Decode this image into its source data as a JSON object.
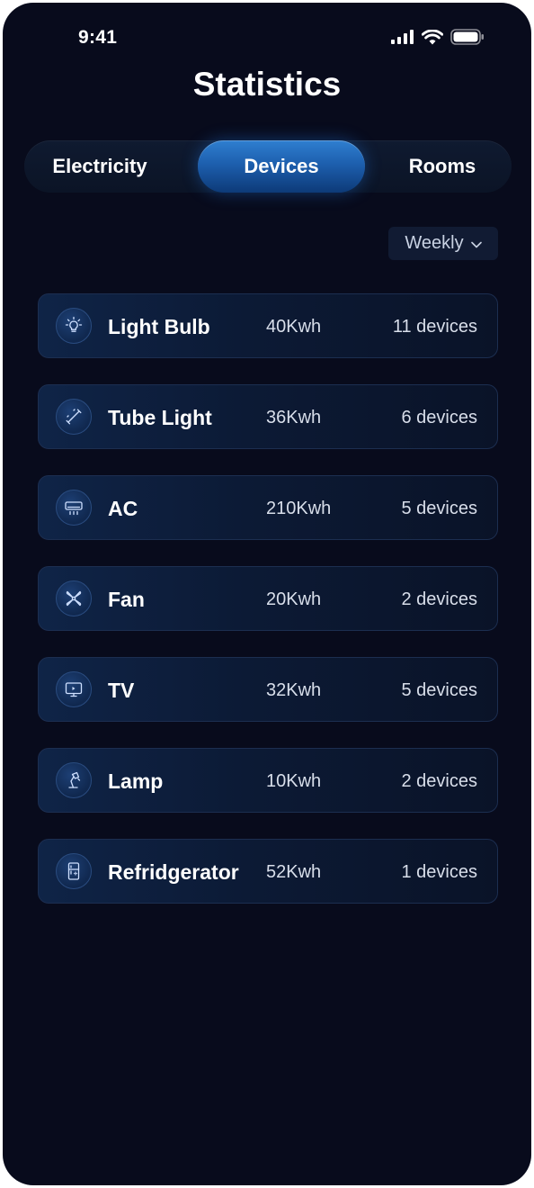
{
  "status_bar": {
    "time": "9:41",
    "icons": [
      "signal-icon",
      "wifi-icon",
      "battery-icon"
    ]
  },
  "header": {
    "title": "Statistics"
  },
  "tabs": [
    {
      "label": "Electricity",
      "active": false
    },
    {
      "label": "Devices",
      "active": true
    },
    {
      "label": "Rooms",
      "active": false
    }
  ],
  "period_filter": {
    "selected": "Weekly",
    "icon": "chevron-down-icon"
  },
  "devices": [
    {
      "name": "Light Bulb",
      "energy": "40Kwh",
      "count": "11 devices",
      "icon": "light-bulb-icon"
    },
    {
      "name": "Tube Light",
      "energy": "36Kwh",
      "count": "6 devices",
      "icon": "tube-light-icon"
    },
    {
      "name": "AC",
      "energy": "210Kwh",
      "count": "5 devices",
      "icon": "ac-icon"
    },
    {
      "name": "Fan",
      "energy": "20Kwh",
      "count": "2 devices",
      "icon": "fan-icon"
    },
    {
      "name": "TV",
      "energy": "32Kwh",
      "count": "5 devices",
      "icon": "tv-icon"
    },
    {
      "name": "Lamp",
      "energy": "10Kwh",
      "count": "2 devices",
      "icon": "lamp-icon"
    },
    {
      "name": "Refridgerator",
      "energy": "52Kwh",
      "count": "1 devices",
      "icon": "refrigerator-icon"
    }
  ],
  "colors": {
    "background": "#080b1c",
    "accent": "#1d5fae",
    "card": "#0f2447",
    "text": "#ffffff"
  }
}
